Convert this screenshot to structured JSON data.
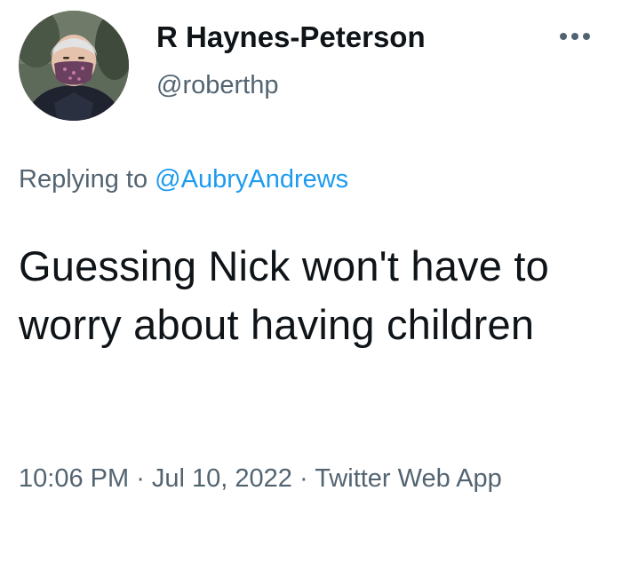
{
  "author": {
    "display_name": "R Haynes-Peterson",
    "handle": "@roberthp",
    "avatar_icon": "user-avatar-photo"
  },
  "more_icon": "more-options-icon",
  "reply": {
    "prefix": "Replying to ",
    "mention": "@AubryAndrews"
  },
  "tweet": {
    "text": "Guessing Nick won't have to worry about having children"
  },
  "meta": {
    "time": "10:06 PM",
    "separator": " · ",
    "date": "Jul 10, 2022",
    "source": "Twitter Web App"
  },
  "colors": {
    "text": "#0f1419",
    "secondary": "#536471",
    "accent": "#1d9bf0"
  }
}
